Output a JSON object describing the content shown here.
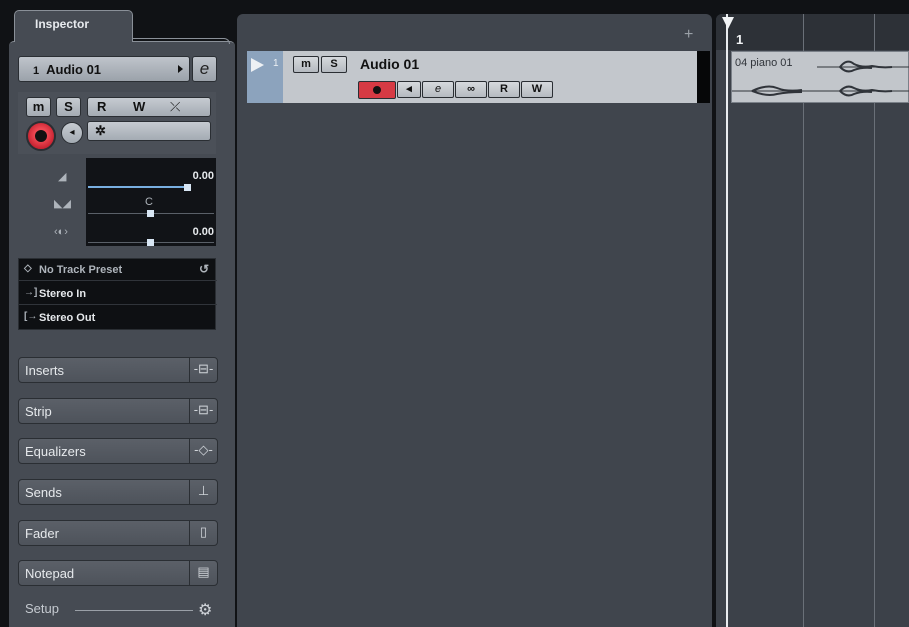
{
  "inspector": {
    "tab_label": "Inspector",
    "track_number": "1",
    "track_name": "Audio 01",
    "buttons": {
      "mute": "m",
      "solo": "S",
      "read": "R",
      "write": "W"
    },
    "volume_value": "0.00",
    "pan_value": "C",
    "delay_value": "0.00",
    "preset": "No Track Preset",
    "input": "Stereo In",
    "output": "Stereo Out",
    "sections": [
      "Inserts",
      "Strip",
      "Equalizers",
      "Sends",
      "Fader",
      "Notepad"
    ],
    "setup_label": "Setup"
  },
  "track": {
    "number": "1",
    "name": "Audio 01",
    "buttons": {
      "mute": "m",
      "solo": "S",
      "read": "R",
      "write": "W"
    }
  },
  "ruler": {
    "bar_start": "1"
  },
  "event": {
    "name": "04 piano 01"
  },
  "colors": {
    "record": "#d63a44",
    "track_color": "#8ca3bd",
    "fader_blue": "#78aee0"
  }
}
